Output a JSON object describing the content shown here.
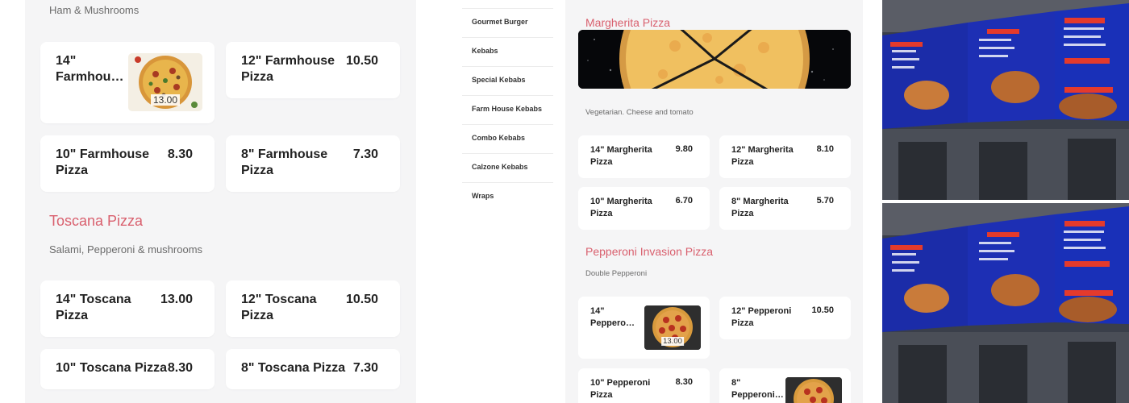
{
  "left_panel": {
    "farmhouse_desc": "Ham & Mushrooms",
    "farmhouse_items": [
      {
        "name": "14\" Farmhou…",
        "name_line1": "14\"",
        "name_line2": "Farmhou…",
        "price": "13.00"
      },
      {
        "name_line1": "12\" Farmhouse",
        "name_line2": "Pizza",
        "price": "10.50"
      },
      {
        "name_line1": "10\" Farmhouse",
        "name_line2": "Pizza",
        "price": "8.30"
      },
      {
        "name_line1": "8\" Farmhouse",
        "name_line2": "Pizza",
        "price": "7.30"
      }
    ],
    "toscana_heading": "Toscana Pizza",
    "toscana_desc": "Salami, Pepperoni & mushrooms",
    "toscana_items": [
      {
        "name_line1": "14\" Toscana",
        "name_line2": "Pizza",
        "price": "13.00"
      },
      {
        "name_line1": "12\" Toscana",
        "name_line2": "Pizza",
        "price": "10.50"
      },
      {
        "name_line1": "10\" Toscana Pizza",
        "price": "8.30"
      },
      {
        "name_line1": "8\" Toscana Pizza",
        "price": "7.30"
      }
    ]
  },
  "categories": [
    "Gourmet Burger",
    "Kebabs",
    "Special Kebabs",
    "Farm House Kebabs",
    "Combo Kebabs",
    "Calzone Kebabs",
    "Wraps"
  ],
  "right_panel": {
    "margherita_heading": "Margherita Pizza",
    "margherita_desc": "Vegetarian. Cheese and tomato",
    "margherita_items": [
      {
        "name_line1": "14\" Margherita",
        "name_line2": "Pizza",
        "price": "9.80"
      },
      {
        "name_line1": "12\" Margherita",
        "name_line2": "Pizza",
        "price": "8.10"
      },
      {
        "name_line1": "10\" Margherita",
        "name_line2": "Pizza",
        "price": "6.70"
      },
      {
        "name_line1": "8\" Margherita",
        "name_line2": "Pizza",
        "price": "5.70"
      }
    ],
    "pepperoni_heading": "Pepperoni Invasion Pizza",
    "pepperoni_desc": "Double Pepperoni",
    "pepperoni_items": [
      {
        "name_line1": "14\"",
        "name_line2": "Peppero…",
        "price": "13.00"
      },
      {
        "name_line1": "12\" Pepperoni",
        "name_line2": "Pizza",
        "price": "10.50"
      },
      {
        "name_line1": "10\" Pepperoni",
        "name_line2": "Pizza",
        "price": "8.30"
      },
      {
        "name_line1": "8\"",
        "name_line2": "Pepperoni…"
      }
    ]
  },
  "colors": {
    "accent_heading": "#d9606e",
    "page_bg": "#f5f5f6",
    "card_bg": "#ffffff"
  },
  "icons": [
    "pizza-thumbnail",
    "pepperoni-pizza-thumbnail",
    "margherita-banner",
    "shop-menu-board-photo"
  ]
}
